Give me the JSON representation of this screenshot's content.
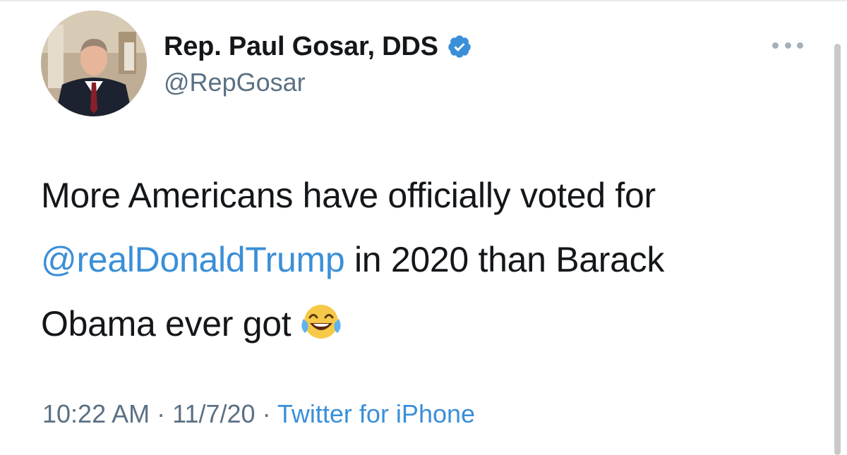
{
  "tweet": {
    "author": {
      "display_name": "Rep. Paul Gosar, DDS",
      "handle": "@RepGosar",
      "verified": true
    },
    "text_lines": [
      {
        "before": "More Americans have officially voted for",
        "mention": "",
        "after": ""
      },
      {
        "before": "",
        "mention": "@realDonaldTrump",
        "after": " in 2020 than Barack"
      },
      {
        "before": "Obama ever got",
        "mention": "",
        "after": ""
      }
    ],
    "emoji": "face-with-tears-of-joy",
    "time": "10:22 AM",
    "separator": " · ",
    "date": "11/7/20",
    "source": "Twitter for iPhone"
  },
  "colors": {
    "text": "#14171a",
    "secondary": "#5b7083",
    "link": "#3a8fd8",
    "verified": "#3a8fd8"
  },
  "icons": {
    "verified": "verified-badge-icon",
    "more": "more-options-icon"
  }
}
